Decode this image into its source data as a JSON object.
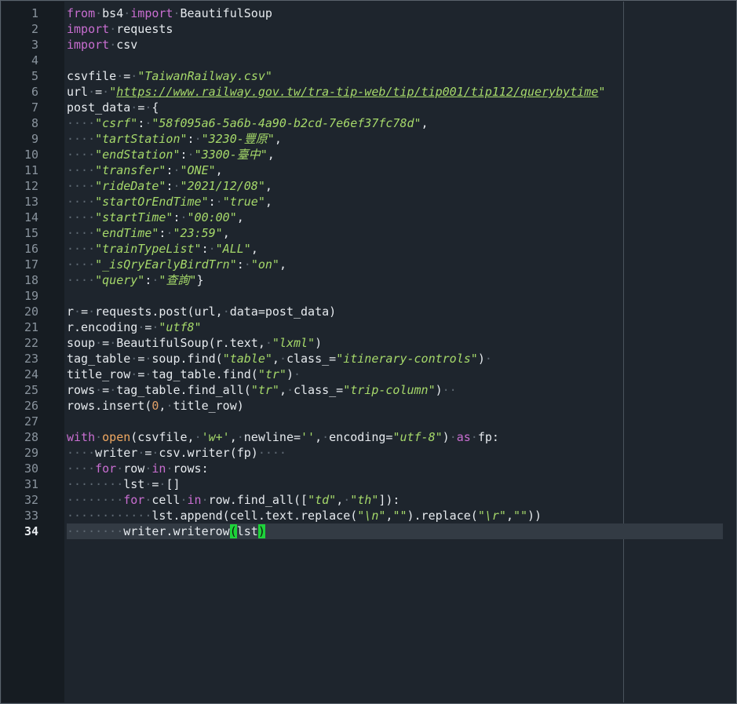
{
  "editor": {
    "active_line": "34",
    "line_numbers": [
      "1",
      "2",
      "3",
      "4",
      "5",
      "6",
      "7",
      "8",
      "9",
      "10",
      "11",
      "12",
      "13",
      "14",
      "15",
      "16",
      "17",
      "18",
      "19",
      "20",
      "21",
      "22",
      "23",
      "24",
      "25",
      "26",
      "27",
      "28",
      "29",
      "30",
      "31",
      "32",
      "33",
      "34"
    ],
    "lines": [
      [
        {
          "t": "from",
          "c": "kw"
        },
        {
          "t": "·",
          "c": "ws"
        },
        {
          "t": "bs4"
        },
        {
          "t": "·",
          "c": "ws"
        },
        {
          "t": "import",
          "c": "kw"
        },
        {
          "t": "·",
          "c": "ws"
        },
        {
          "t": "BeautifulSoup"
        }
      ],
      [
        {
          "t": "import",
          "c": "kw"
        },
        {
          "t": "·",
          "c": "ws"
        },
        {
          "t": "requests"
        }
      ],
      [
        {
          "t": "import",
          "c": "kw"
        },
        {
          "t": "·",
          "c": "ws"
        },
        {
          "t": "csv"
        }
      ],
      [],
      [
        {
          "t": "csvfile"
        },
        {
          "t": "·",
          "c": "ws"
        },
        {
          "t": "="
        },
        {
          "t": "·",
          "c": "ws"
        },
        {
          "t": "\"TaiwanRailway.csv\"",
          "c": "str"
        }
      ],
      [
        {
          "t": "url"
        },
        {
          "t": "·",
          "c": "ws"
        },
        {
          "t": "="
        },
        {
          "t": "·",
          "c": "ws"
        },
        {
          "t": "\"",
          "c": "str"
        },
        {
          "t": "https://www.railway.gov.tw/tra-tip-web/tip/tip001/tip112/querybytime",
          "c": "lnk"
        },
        {
          "t": "\"",
          "c": "str"
        }
      ],
      [
        {
          "t": "post_data"
        },
        {
          "t": "·",
          "c": "ws"
        },
        {
          "t": "="
        },
        {
          "t": "·",
          "c": "ws"
        },
        {
          "t": "{"
        }
      ],
      [
        {
          "t": "····",
          "c": "ws"
        },
        {
          "t": "\"csrf\"",
          "c": "str"
        },
        {
          "t": ":"
        },
        {
          "t": "·",
          "c": "ws"
        },
        {
          "t": "\"58f095a6-5a6b-4a90-b2cd-7e6ef37fc78d\"",
          "c": "str"
        },
        {
          "t": ","
        }
      ],
      [
        {
          "t": "····",
          "c": "ws"
        },
        {
          "t": "\"tartStation\"",
          "c": "str"
        },
        {
          "t": ":"
        },
        {
          "t": "·",
          "c": "ws"
        },
        {
          "t": "\"3230-豐原\"",
          "c": "str"
        },
        {
          "t": ","
        }
      ],
      [
        {
          "t": "····",
          "c": "ws"
        },
        {
          "t": "\"endStation\"",
          "c": "str"
        },
        {
          "t": ":"
        },
        {
          "t": "·",
          "c": "ws"
        },
        {
          "t": "\"3300-臺中\"",
          "c": "str"
        },
        {
          "t": ","
        }
      ],
      [
        {
          "t": "····",
          "c": "ws"
        },
        {
          "t": "\"transfer\"",
          "c": "str"
        },
        {
          "t": ":"
        },
        {
          "t": "·",
          "c": "ws"
        },
        {
          "t": "\"ONE\"",
          "c": "str"
        },
        {
          "t": ","
        }
      ],
      [
        {
          "t": "····",
          "c": "ws"
        },
        {
          "t": "\"rideDate\"",
          "c": "str"
        },
        {
          "t": ":"
        },
        {
          "t": "·",
          "c": "ws"
        },
        {
          "t": "\"2021/12/08\"",
          "c": "str"
        },
        {
          "t": ","
        }
      ],
      [
        {
          "t": "····",
          "c": "ws"
        },
        {
          "t": "\"startOrEndTime\"",
          "c": "str"
        },
        {
          "t": ":"
        },
        {
          "t": "·",
          "c": "ws"
        },
        {
          "t": "\"true\"",
          "c": "str"
        },
        {
          "t": ","
        }
      ],
      [
        {
          "t": "····",
          "c": "ws"
        },
        {
          "t": "\"startTime\"",
          "c": "str"
        },
        {
          "t": ":"
        },
        {
          "t": "·",
          "c": "ws"
        },
        {
          "t": "\"00:00\"",
          "c": "str"
        },
        {
          "t": ","
        }
      ],
      [
        {
          "t": "····",
          "c": "ws"
        },
        {
          "t": "\"endTime\"",
          "c": "str"
        },
        {
          "t": ":"
        },
        {
          "t": "·",
          "c": "ws"
        },
        {
          "t": "\"23:59\"",
          "c": "str"
        },
        {
          "t": ","
        }
      ],
      [
        {
          "t": "····",
          "c": "ws"
        },
        {
          "t": "\"trainTypeList\"",
          "c": "str"
        },
        {
          "t": ":"
        },
        {
          "t": "·",
          "c": "ws"
        },
        {
          "t": "\"ALL\"",
          "c": "str"
        },
        {
          "t": ","
        }
      ],
      [
        {
          "t": "····",
          "c": "ws"
        },
        {
          "t": "\"_isQryEarlyBirdTrn\"",
          "c": "str"
        },
        {
          "t": ":"
        },
        {
          "t": "·",
          "c": "ws"
        },
        {
          "t": "\"on\"",
          "c": "str"
        },
        {
          "t": ","
        }
      ],
      [
        {
          "t": "····",
          "c": "ws"
        },
        {
          "t": "\"query\"",
          "c": "str"
        },
        {
          "t": ":"
        },
        {
          "t": "·",
          "c": "ws"
        },
        {
          "t": "\"查詢\"",
          "c": "str"
        },
        {
          "t": "}"
        }
      ],
      [],
      [
        {
          "t": "r"
        },
        {
          "t": "·",
          "c": "ws"
        },
        {
          "t": "="
        },
        {
          "t": "·",
          "c": "ws"
        },
        {
          "t": "requests.post(url,"
        },
        {
          "t": "·",
          "c": "ws"
        },
        {
          "t": "data=post_data)"
        }
      ],
      [
        {
          "t": "r.encoding"
        },
        {
          "t": "·",
          "c": "ws"
        },
        {
          "t": "="
        },
        {
          "t": "·",
          "c": "ws"
        },
        {
          "t": "\"utf8\"",
          "c": "str"
        }
      ],
      [
        {
          "t": "soup"
        },
        {
          "t": "·",
          "c": "ws"
        },
        {
          "t": "="
        },
        {
          "t": "·",
          "c": "ws"
        },
        {
          "t": "BeautifulSoup(r.text,"
        },
        {
          "t": "·",
          "c": "ws"
        },
        {
          "t": "\"lxml\"",
          "c": "str"
        },
        {
          "t": ")"
        }
      ],
      [
        {
          "t": "tag_table"
        },
        {
          "t": "·",
          "c": "ws"
        },
        {
          "t": "="
        },
        {
          "t": "·",
          "c": "ws"
        },
        {
          "t": "soup.find("
        },
        {
          "t": "\"table\"",
          "c": "str"
        },
        {
          "t": ","
        },
        {
          "t": "·",
          "c": "ws"
        },
        {
          "t": "class_="
        },
        {
          "t": "\"itinerary-controls\"",
          "c": "str"
        },
        {
          "t": ")"
        },
        {
          "t": "·",
          "c": "ws"
        }
      ],
      [
        {
          "t": "title_row"
        },
        {
          "t": "·",
          "c": "ws"
        },
        {
          "t": "="
        },
        {
          "t": "·",
          "c": "ws"
        },
        {
          "t": "tag_table.find("
        },
        {
          "t": "\"tr\"",
          "c": "str"
        },
        {
          "t": ")"
        },
        {
          "t": "·",
          "c": "ws"
        }
      ],
      [
        {
          "t": "rows"
        },
        {
          "t": "·",
          "c": "ws"
        },
        {
          "t": "="
        },
        {
          "t": "·",
          "c": "ws"
        },
        {
          "t": "tag_table.find_all("
        },
        {
          "t": "\"tr\"",
          "c": "str"
        },
        {
          "t": ","
        },
        {
          "t": "·",
          "c": "ws"
        },
        {
          "t": "class_="
        },
        {
          "t": "\"trip-column\"",
          "c": "str"
        },
        {
          "t": ")"
        },
        {
          "t": "··",
          "c": "ws"
        }
      ],
      [
        {
          "t": "rows.insert("
        },
        {
          "t": "0",
          "c": "num"
        },
        {
          "t": ","
        },
        {
          "t": "·",
          "c": "ws"
        },
        {
          "t": "title_row)"
        }
      ],
      [],
      [
        {
          "t": "with",
          "c": "kw"
        },
        {
          "t": "·",
          "c": "ws"
        },
        {
          "t": "open",
          "c": "fn"
        },
        {
          "t": "(csvfile,"
        },
        {
          "t": "·",
          "c": "ws"
        },
        {
          "t": "'w+'",
          "c": "str"
        },
        {
          "t": ","
        },
        {
          "t": "·",
          "c": "ws"
        },
        {
          "t": "newline="
        },
        {
          "t": "''",
          "c": "str"
        },
        {
          "t": ","
        },
        {
          "t": "·",
          "c": "ws"
        },
        {
          "t": "encoding="
        },
        {
          "t": "\"utf-8\"",
          "c": "str"
        },
        {
          "t": ")"
        },
        {
          "t": "·",
          "c": "ws"
        },
        {
          "t": "as",
          "c": "kw"
        },
        {
          "t": "·",
          "c": "ws"
        },
        {
          "t": "fp:"
        }
      ],
      [
        {
          "t": "····",
          "c": "ws"
        },
        {
          "t": "writer"
        },
        {
          "t": "·",
          "c": "ws"
        },
        {
          "t": "="
        },
        {
          "t": "·",
          "c": "ws"
        },
        {
          "t": "csv.writer(fp)"
        },
        {
          "t": "····",
          "c": "ws"
        }
      ],
      [
        {
          "t": "····",
          "c": "ws"
        },
        {
          "t": "for",
          "c": "kw"
        },
        {
          "t": "·",
          "c": "ws"
        },
        {
          "t": "row"
        },
        {
          "t": "·",
          "c": "ws"
        },
        {
          "t": "in",
          "c": "kw"
        },
        {
          "t": "·",
          "c": "ws"
        },
        {
          "t": "rows:"
        }
      ],
      [
        {
          "t": "········",
          "c": "ws"
        },
        {
          "t": "lst"
        },
        {
          "t": "·",
          "c": "ws"
        },
        {
          "t": "="
        },
        {
          "t": "·",
          "c": "ws"
        },
        {
          "t": "[]"
        }
      ],
      [
        {
          "t": "········",
          "c": "ws"
        },
        {
          "t": "for",
          "c": "kw"
        },
        {
          "t": "·",
          "c": "ws"
        },
        {
          "t": "cell"
        },
        {
          "t": "·",
          "c": "ws"
        },
        {
          "t": "in",
          "c": "kw"
        },
        {
          "t": "·",
          "c": "ws"
        },
        {
          "t": "row.find_all(["
        },
        {
          "t": "\"td\"",
          "c": "str"
        },
        {
          "t": ","
        },
        {
          "t": "·",
          "c": "ws"
        },
        {
          "t": "\"th\"",
          "c": "str"
        },
        {
          "t": "]):"
        }
      ],
      [
        {
          "t": "············",
          "c": "ws"
        },
        {
          "t": "lst.append(cell.text.replace("
        },
        {
          "t": "\"\\n\"",
          "c": "str"
        },
        {
          "t": ","
        },
        {
          "t": "\"\"",
          "c": "str"
        },
        {
          "t": ").replace("
        },
        {
          "t": "\"\\r\"",
          "c": "str"
        },
        {
          "t": ","
        },
        {
          "t": "\"\"",
          "c": "str"
        },
        {
          "t": "))"
        }
      ],
      [
        {
          "t": "········",
          "c": "ws"
        },
        {
          "t": "writer.writerow"
        },
        {
          "t": "(",
          "c": "bm"
        },
        {
          "t": "lst"
        },
        {
          "t": ")",
          "c": "bm"
        }
      ]
    ]
  }
}
